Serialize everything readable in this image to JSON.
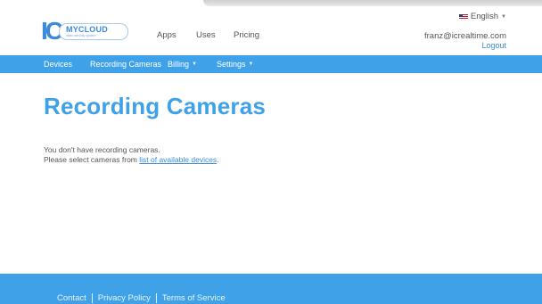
{
  "brand": {
    "logo_mark": "IC",
    "logo_name": "MYCLOUD",
    "logo_tagline": "video security system"
  },
  "top_nav": {
    "apps": "Apps",
    "uses": "Uses",
    "pricing": "Pricing"
  },
  "account": {
    "language": "English",
    "email": "franz@icrealtime.com",
    "logout": "Logout"
  },
  "main_nav": {
    "devices": "Devices",
    "recording_cameras": "Recording Cameras",
    "billing": "Billing",
    "settings": "Settings"
  },
  "page": {
    "title": "Recording Cameras",
    "empty_message": "You don't have recording cameras.",
    "select_prefix": "Please select cameras from",
    "select_link": "list of available devices",
    "select_suffix": "."
  },
  "footer": {
    "contact": "Contact",
    "privacy": "Privacy Policy",
    "terms": "Terms of Service"
  },
  "colors": {
    "accent": "#3fa1e8",
    "link": "#3b8bdb"
  },
  "icons": [
    "us-flag-icon",
    "caret-down-icon"
  ]
}
